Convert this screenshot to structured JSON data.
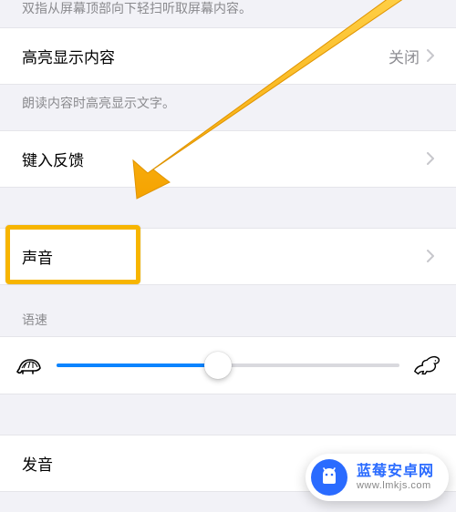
{
  "top_hint": "双指从屏幕顶部向下轻扫听取屏幕内容。",
  "highlight_content": {
    "label": "高亮显示内容",
    "value": "关闭"
  },
  "highlight_note": "朗读内容时高亮显示文字。",
  "typing_feedback": {
    "label": "键入反馈"
  },
  "voice": {
    "label": "声音"
  },
  "rate": {
    "header": "语速",
    "percent": 47
  },
  "pronunciation": {
    "label": "发音"
  },
  "watermark": {
    "title": "蓝莓安卓网",
    "url": "www.lmkjs.com"
  }
}
